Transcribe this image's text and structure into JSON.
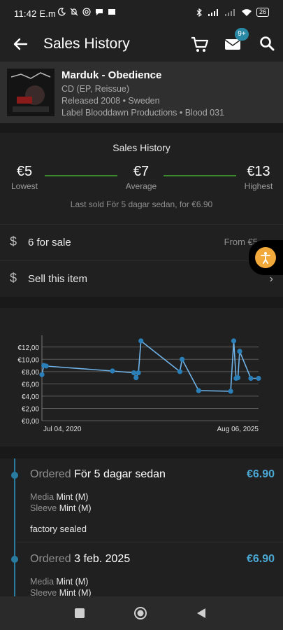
{
  "status": {
    "time": "11:42 E.m",
    "battery": "26"
  },
  "appbar": {
    "title": "Sales History",
    "badge": "9+"
  },
  "release": {
    "title": "Marduk - Obedience",
    "format": "CD (EP, Reissue)",
    "released": "Released 2008  • Sweden",
    "label": "Label Blooddawn Productions • Blood 031"
  },
  "summary": {
    "title": "Sales History",
    "lowest_value": "€5",
    "lowest_label": "Lowest",
    "average_value": "€7",
    "average_label": "Average",
    "highest_value": "€13",
    "highest_label": "Highest",
    "last_sold": "Last sold För 5 dagar sedan, for €6.90"
  },
  "rows": {
    "for_sale_label": "6 for sale",
    "for_sale_right": "From €5",
    "sell_label": "Sell this item"
  },
  "chart_data": {
    "type": "line",
    "x_start_label": "Jul 04, 2020",
    "x_end_label": "Aug 06, 2025",
    "y_ticks": [
      "€0,00",
      "€2,00",
      "€4,00",
      "€6,00",
      "€8,00",
      "€10,00",
      "€12,00"
    ],
    "ylim": [
      0,
      13
    ],
    "grid": true,
    "color": "#6fb3e8",
    "x": [
      "2020-07-04",
      "2020-07-20",
      "2020-08-10",
      "2022-03-01",
      "2022-09-01",
      "2022-09-20",
      "2022-10-10",
      "2022-11-01",
      "2023-10-01",
      "2023-10-20",
      "2024-03-10",
      "2024-12-10",
      "2025-01-05",
      "2025-01-25",
      "2025-02-10",
      "2025-02-25",
      "2025-06-01",
      "2025-08-06"
    ],
    "values": [
      7.5,
      9,
      8.9,
      8.1,
      7.8,
      7,
      7.8,
      13,
      8,
      10,
      4.9,
      4.8,
      13,
      6.9,
      7,
      11.3,
      6.9,
      6.9
    ]
  },
  "orders": [
    {
      "ordered_label": "Ordered",
      "date": "För 5 dagar sedan",
      "price": "€6.90",
      "media_label": "Media",
      "media_value": "Mint (M)",
      "sleeve_label": "Sleeve",
      "sleeve_value": "Mint (M)",
      "note": "factory sealed"
    },
    {
      "ordered_label": "Ordered",
      "date": "3 feb. 2025",
      "price": "€6.90",
      "media_label": "Media",
      "media_value": "Mint (M)",
      "sleeve_label": "Sleeve",
      "sleeve_value": "Mint (M)"
    }
  ]
}
